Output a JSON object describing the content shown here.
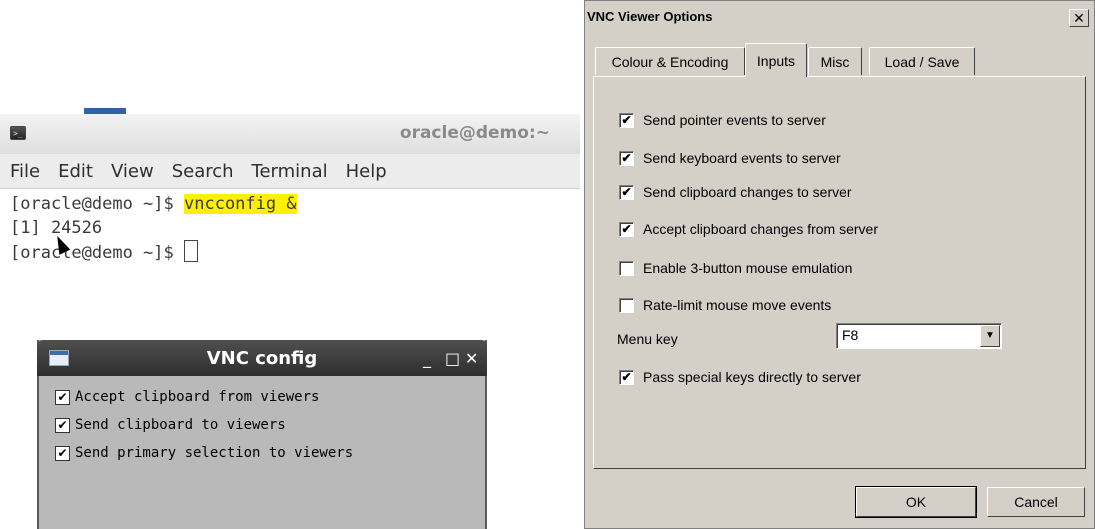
{
  "terminal": {
    "title": "oracle@demo:~",
    "menu": [
      "File",
      "Edit",
      "View",
      "Search",
      "Terminal",
      "Help"
    ],
    "lines": {
      "l1_prompt": "[oracle@demo ~]$ ",
      "l1_cmd": "vncconfig &",
      "l2": "[1] 24526",
      "l3_prompt": "[oracle@demo ~]$ "
    }
  },
  "vnc_config": {
    "title": "VNC config",
    "controls": {
      "minimize": "_",
      "maximize": "□",
      "close": "✕"
    },
    "options": [
      {
        "label": "Accept clipboard from viewers",
        "checked": true
      },
      {
        "label": "Send clipboard to viewers",
        "checked": true
      },
      {
        "label": "Send primary selection to viewers",
        "checked": true
      }
    ]
  },
  "viewer_options": {
    "title": "VNC Viewer Options",
    "close": "✕",
    "tabs": [
      {
        "label": "Colour & Encoding",
        "active": false
      },
      {
        "label": "Inputs",
        "active": true
      },
      {
        "label": "Misc",
        "active": false
      },
      {
        "label": "Load / Save",
        "active": false
      }
    ],
    "checks": [
      {
        "label": "Send pointer events to server",
        "checked": true
      },
      {
        "label": "Send keyboard events to server",
        "checked": true
      },
      {
        "label": "Send clipboard changes to server",
        "checked": true
      },
      {
        "label": "Accept clipboard changes from server",
        "checked": true
      },
      {
        "label": "Enable 3-button mouse emulation",
        "checked": false
      },
      {
        "label": "Rate-limit mouse move events",
        "checked": false
      }
    ],
    "menu_key": {
      "label": "Menu key",
      "value": "F8"
    },
    "pass_special": {
      "label": "Pass special keys directly to server",
      "checked": true
    },
    "buttons": {
      "ok": "OK",
      "cancel": "Cancel"
    }
  }
}
